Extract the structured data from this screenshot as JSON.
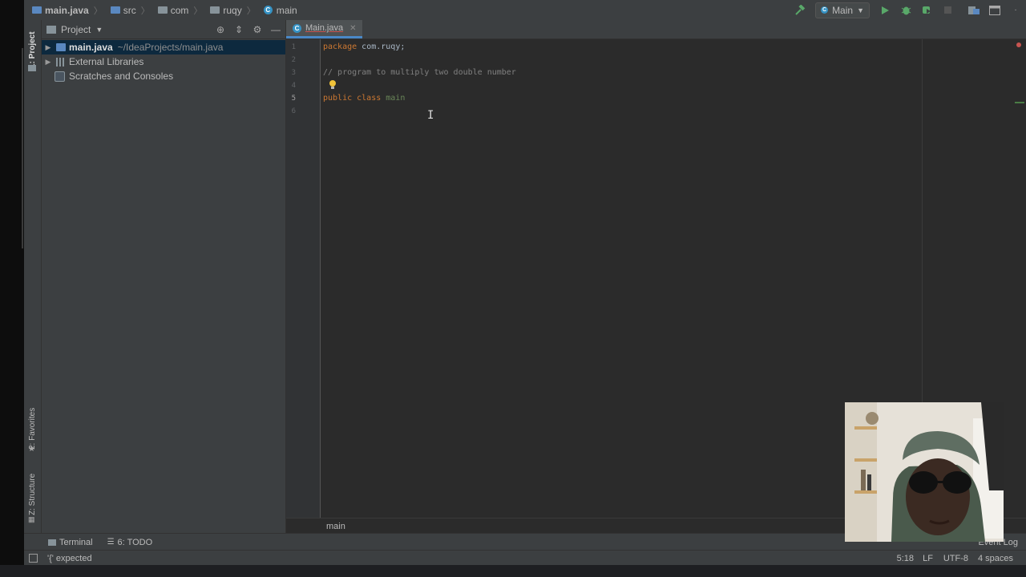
{
  "navbar": {
    "crumbs": [
      "main.java",
      "src",
      "com",
      "ruqy",
      "main"
    ],
    "run_config": "Main"
  },
  "stripe": {
    "project": "1: Project",
    "favorites": "2: Favorites",
    "structure": "Z: Structure"
  },
  "project_panel": {
    "title": "Project",
    "items": [
      {
        "label": "main.java",
        "path": "~/IdeaProjects/main.java"
      },
      {
        "label": "External Libraries"
      },
      {
        "label": "Scratches and Consoles"
      }
    ]
  },
  "editor": {
    "tab_label": "Main.java",
    "line_numbers": [
      "1",
      "2",
      "3",
      "4",
      "5",
      "6"
    ],
    "lines": {
      "l1_kw": "package",
      "l1_rest": " com.ruqy;",
      "l3": "// program to multiply two double number",
      "l5_kw": "public class",
      "l5_name": " main"
    },
    "breadcrumb": "main"
  },
  "tool_windows": {
    "terminal": "Terminal",
    "todo": "6: TODO",
    "event_log": "Event Log"
  },
  "status": {
    "message": "'{' expected",
    "position": "5:18",
    "line_sep": "LF",
    "encoding": "UTF-8",
    "indent": "4 spaces"
  },
  "colors": {
    "accent": "#4a88c7",
    "keyword": "#cc7832",
    "comment": "#808080",
    "run_green": "#59a869"
  }
}
